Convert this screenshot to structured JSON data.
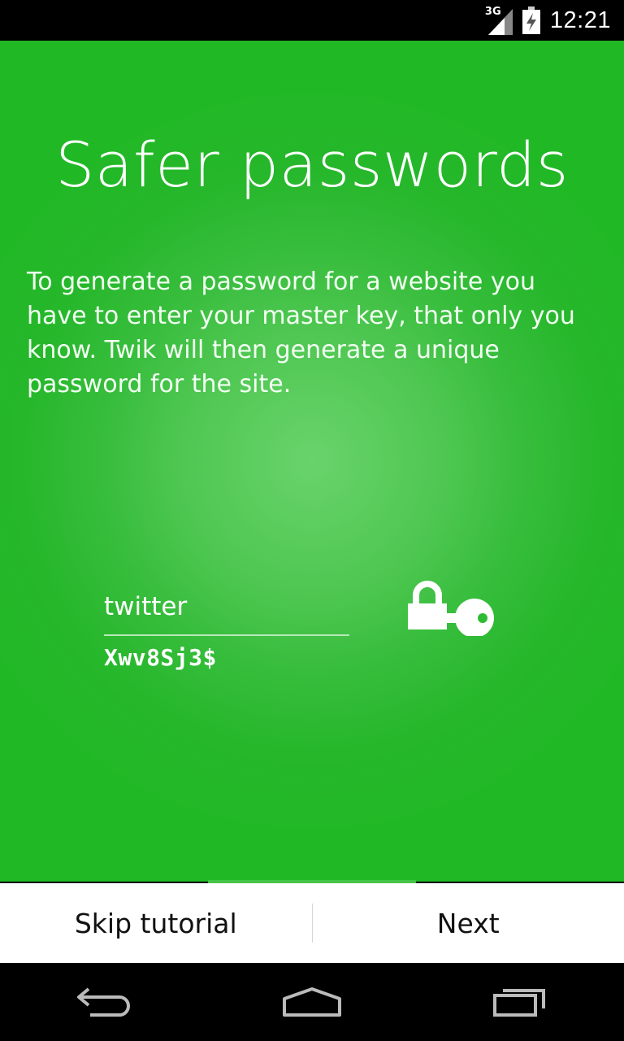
{
  "status_bar": {
    "network": "3G",
    "time": "12:21",
    "icons": [
      "signal-3g-icon",
      "battery-charging-icon"
    ]
  },
  "tutorial": {
    "title": "Safer passwords",
    "description": "To generate a password for a website you have to enter your master key, that only you know. Twik will then generate a unique password for the site.",
    "site_value": "twitter",
    "generated_password": "Xwv8Sj3$",
    "icon": "lock-key-icon",
    "page_indicator": {
      "current": 2,
      "total": 3
    }
  },
  "buttons": {
    "skip_label": "Skip tutorial",
    "next_label": "Next"
  },
  "nav_bar": {
    "icons": [
      "back-icon",
      "home-icon",
      "recent-apps-icon"
    ]
  },
  "colors": {
    "accent": "#21b826",
    "highlight": "#69d36b"
  }
}
